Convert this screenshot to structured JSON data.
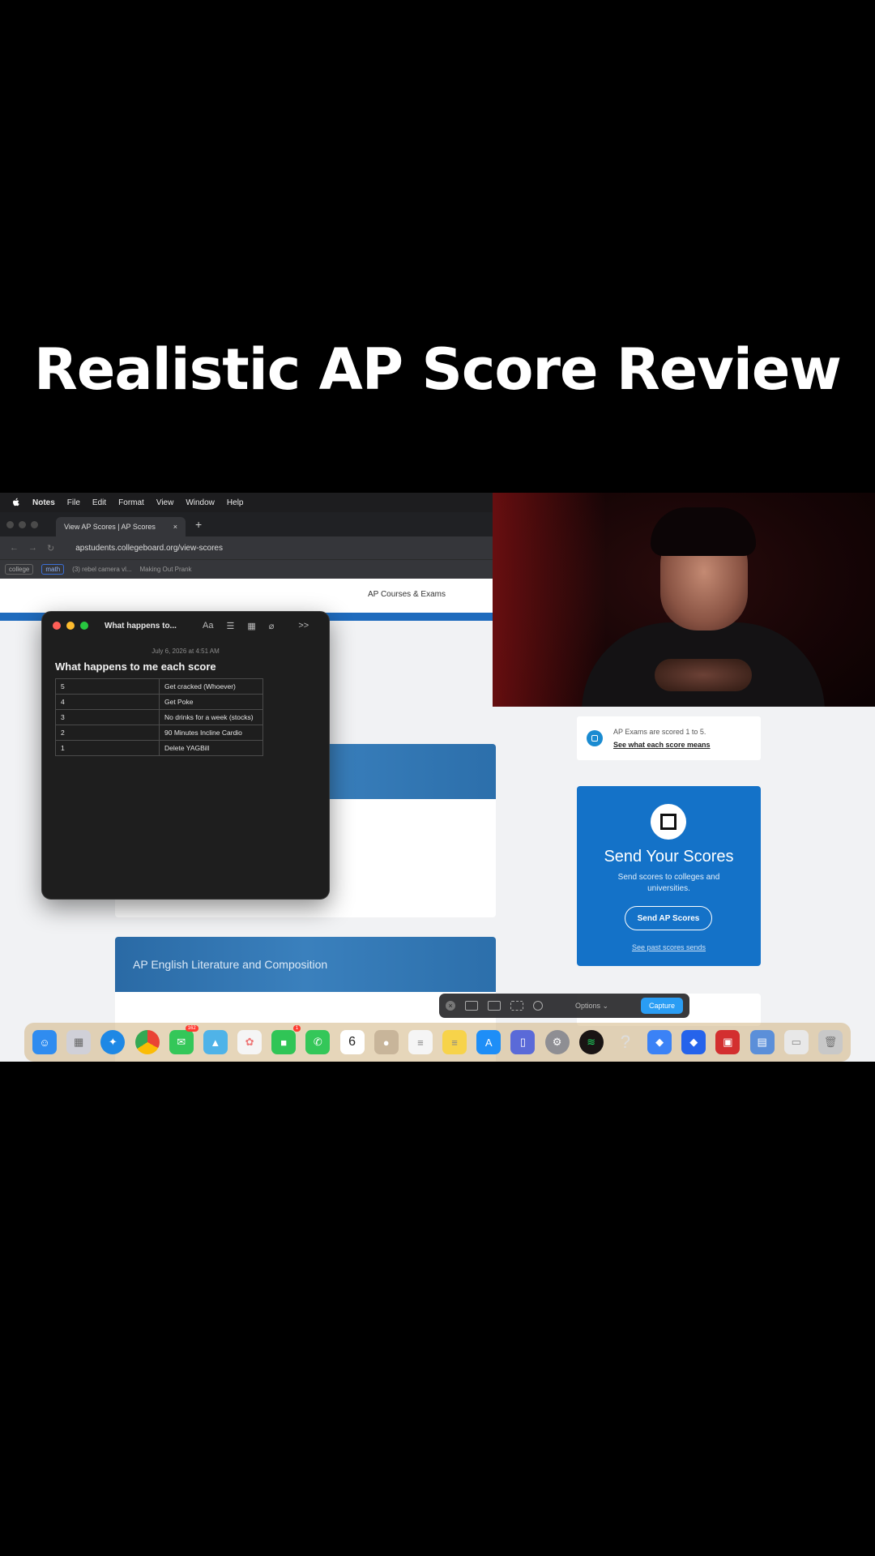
{
  "video": {
    "title": "Realistic AP Score Review"
  },
  "menubar": {
    "app": "Notes",
    "items": [
      "File",
      "Edit",
      "Format",
      "View",
      "Window",
      "Help"
    ]
  },
  "browser": {
    "tab_title": "View AP Scores | AP Scores",
    "tab_close": "×",
    "new_tab": "+",
    "url": "apstudents.collegeboard.org/view-scores",
    "bookmarks": [
      "college",
      "math",
      "(3) rebel camera vl...",
      "Making Out Prank"
    ]
  },
  "site": {
    "nav_courses": "AP Courses & Exams",
    "course_card_title": "AP English Literature and Composition",
    "info_text": "AP Exams are scored 1 to 5.",
    "info_link": "See what each score means",
    "send_title": "Send Your Scores",
    "send_sub": "Send scores to colleges and universities.",
    "send_button": "Send AP Scores",
    "send_link": "See past scores sends"
  },
  "notes": {
    "window_title": "What happens to...",
    "toolbar_format": "Aa",
    "toolbar_more": ">>",
    "date": "July 6, 2026 at 4:51 AM",
    "heading": "What happens to me each score",
    "rows": [
      {
        "score": "5",
        "action": "Get cracked (Whoever)"
      },
      {
        "score": "4",
        "action": "Get Poke"
      },
      {
        "score": "3",
        "action": "No drinks for a week (stocks)"
      },
      {
        "score": "2",
        "action": "90 Minutes Incline Cardio"
      },
      {
        "score": "1",
        "action": "Delete YAGBill"
      }
    ]
  },
  "screenshot_toolbar": {
    "options": "Options ⌄",
    "capture": "Capture"
  },
  "dock": {
    "calendar_day": "6",
    "messages_badge": "162",
    "facetime_badge": "1",
    "apps": [
      {
        "name": "finder",
        "color": "#2f8cf0"
      },
      {
        "name": "launchpad",
        "color": "#d0d0d8"
      },
      {
        "name": "safari",
        "color": "#1e88e5"
      },
      {
        "name": "chrome",
        "color": "#e0e0e0"
      },
      {
        "name": "messages",
        "color": "#34c759"
      },
      {
        "name": "maps",
        "color": "#4fb3e8"
      },
      {
        "name": "photos",
        "color": "#f5f5f5"
      },
      {
        "name": "facetime",
        "color": "#30c556"
      },
      {
        "name": "phone",
        "color": "#34c759"
      },
      {
        "name": "calendar",
        "color": "#ffffff"
      },
      {
        "name": "contacts",
        "color": "#c8b59a"
      },
      {
        "name": "reminders",
        "color": "#f5f5f5"
      },
      {
        "name": "notes",
        "color": "#f7d34a"
      },
      {
        "name": "app-store",
        "color": "#1e8ef7"
      },
      {
        "name": "simulator",
        "color": "#5a6ad8"
      },
      {
        "name": "system-settings",
        "color": "#8e8e93"
      },
      {
        "name": "spotify",
        "color": "#191414"
      },
      {
        "name": "help",
        "color": "transparent"
      },
      {
        "name": "roblox",
        "color": "#3b82f6"
      },
      {
        "name": "roblox-studio",
        "color": "#2563eb"
      },
      {
        "name": "photo-booth",
        "color": "#d32f2f"
      },
      {
        "name": "preview",
        "color": "#5b8fd9"
      },
      {
        "name": "downloads",
        "color": "#e8e8e8"
      },
      {
        "name": "trash",
        "color": "#c8c8c8"
      }
    ]
  }
}
